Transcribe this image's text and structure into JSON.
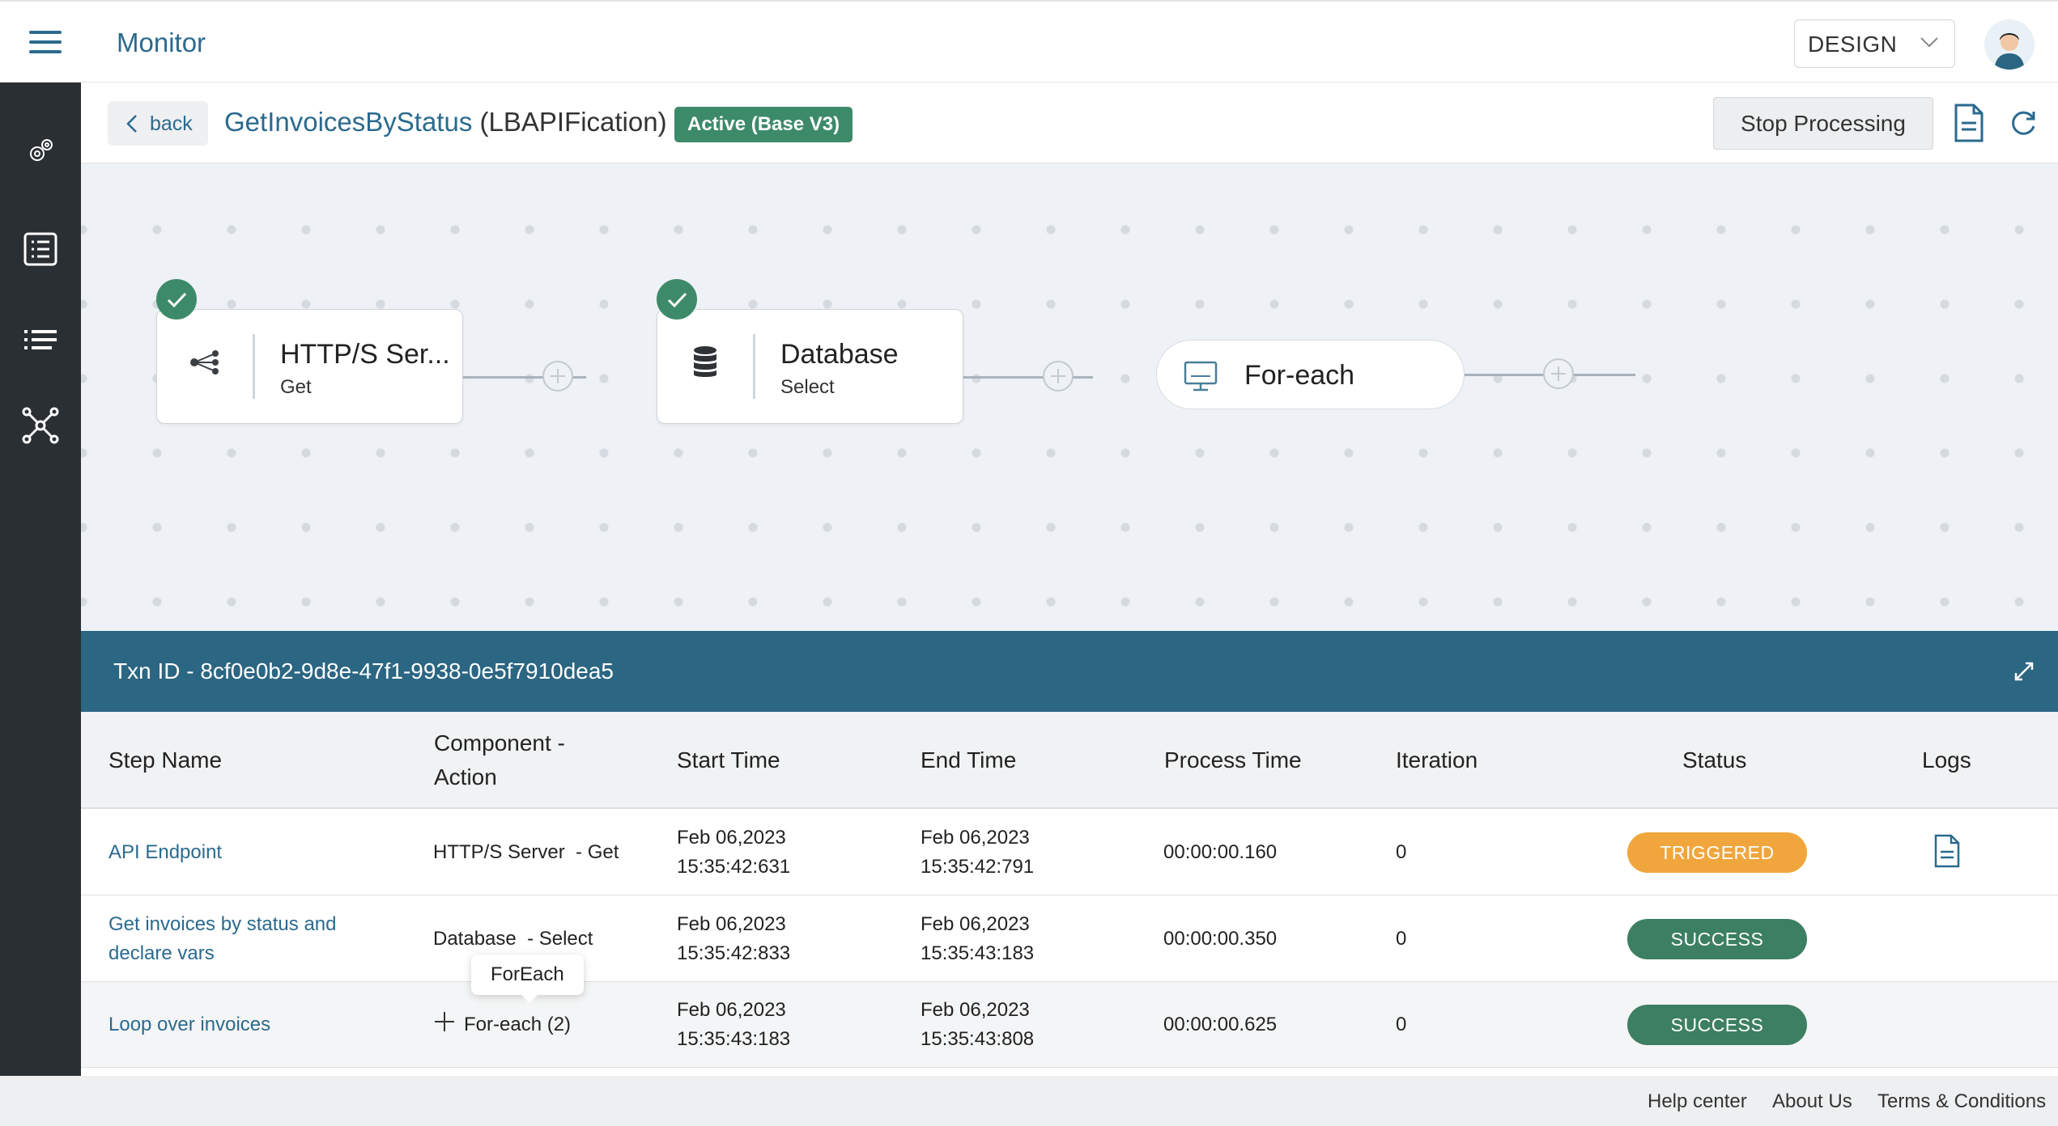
{
  "app": {
    "title": "Monitor",
    "mode": "DESIGN"
  },
  "sidebar": {
    "items": [
      "settings-gears-icon",
      "list-document-icon",
      "bullet-list-icon",
      "network-nodes-icon"
    ]
  },
  "header": {
    "back_label": "back",
    "flow_name": "GetInvoicesByStatus",
    "flow_sub": "(LBAPIFication)",
    "status": "Active (Base V3)",
    "stop_label": "Stop Processing"
  },
  "canvas": {
    "nodes": [
      {
        "title": "HTTP/S Ser...",
        "sub": "Get",
        "icon": "share-nodes-icon",
        "checked": true
      },
      {
        "title": "Database",
        "sub": "Select",
        "icon": "database-icon",
        "checked": true
      },
      {
        "title": "For-each",
        "sub": "",
        "icon": "monitor-icon",
        "checked": false
      }
    ]
  },
  "txn": {
    "id_label": "Txn ID - 8cf0e0b2-9d8e-47f1-9938-0e5f7910dea5",
    "columns": [
      "Step Name",
      "Component -\nAction",
      "Start Time",
      "End Time",
      "Process Time",
      "Iteration",
      "Status",
      "Logs"
    ],
    "rows": [
      {
        "step": "API Endpoint",
        "component": "HTTP/S Server  - Get",
        "start": "Feb 06,2023\n15:35:42:631",
        "end": "Feb 06,2023\n15:35:42:791",
        "process": "00:00:00.160",
        "iteration": "0",
        "status": "TRIGGERED"
      },
      {
        "step": "Get invoices by status and\ndeclare vars",
        "component": "Database  - Select",
        "start": "Feb 06,2023\n15:35:42:833",
        "end": "Feb 06,2023\n15:35:43:183",
        "process": "00:00:00.350",
        "iteration": "0",
        "status": "SUCCESS"
      },
      {
        "step": "Loop over invoices",
        "component": "For-each (2)",
        "start": "Feb 06,2023\n15:35:43:183",
        "end": "Feb 06,2023\n15:35:43:808",
        "process": "00:00:00.625",
        "iteration": "0",
        "status": "SUCCESS"
      }
    ],
    "tooltip": "ForEach"
  },
  "footer": {
    "links": [
      "Help center",
      "About Us",
      "Terms & Conditions"
    ]
  },
  "colors": {
    "accent": "#2b6a8e",
    "success": "#3d7f62",
    "triggered": "#f0a63d",
    "sidebar": "#2a2f33",
    "panel": "#2b6682"
  }
}
